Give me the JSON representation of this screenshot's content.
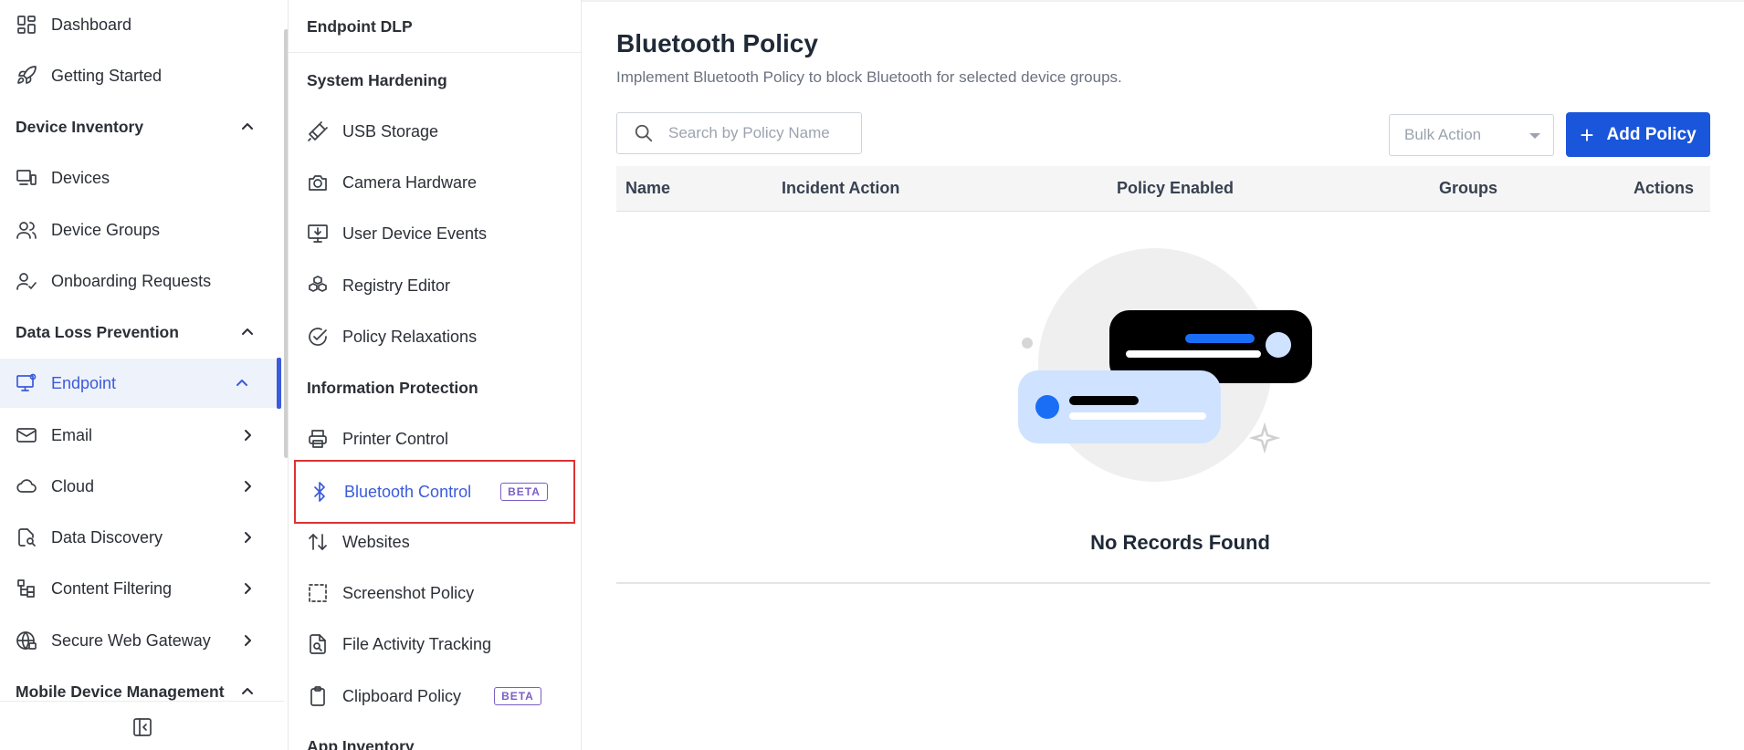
{
  "sidebar": {
    "items": {
      "dashboard": "Dashboard",
      "getting_started": "Getting Started",
      "device_inventory": "Device Inventory",
      "devices": "Devices",
      "device_groups": "Device Groups",
      "onboarding_requests": "Onboarding Requests",
      "data_loss_prevention": "Data Loss Prevention",
      "endpoint": "Endpoint",
      "email": "Email",
      "cloud": "Cloud",
      "data_discovery": "Data Discovery",
      "content_filtering": "Content Filtering",
      "secure_web_gateway": "Secure Web Gateway",
      "mobile_device_management": "Mobile Device Management"
    },
    "active_color": "#3b5bdb"
  },
  "subpanel": {
    "header": "Endpoint DLP",
    "sections": {
      "system_hardening": "System Hardening",
      "information_protection": "Information Protection",
      "app_inventory": "App Inventory"
    },
    "items": {
      "usb_storage": "USB Storage",
      "camera_hardware": "Camera Hardware",
      "user_device_events": "User Device Events",
      "registry_editor": "Registry Editor",
      "policy_relaxations": "Policy Relaxations",
      "printer_control": "Printer Control",
      "bluetooth_control": "Bluetooth Control",
      "websites": "Websites",
      "screenshot_policy": "Screenshot Policy",
      "file_activity_tracking": "File Activity Tracking",
      "clipboard_policy": "Clipboard Policy"
    },
    "badge_beta": "BETA"
  },
  "main": {
    "title": "Bluetooth Policy",
    "subtitle": "Implement Bluetooth Policy to block Bluetooth for selected device groups.",
    "search_placeholder": "Search by Policy Name",
    "bulk_action": "Bulk Action",
    "add_policy": "Add Policy",
    "columns": {
      "name": "Name",
      "incident_action": "Incident Action",
      "policy_enabled": "Policy Enabled",
      "groups": "Groups",
      "actions": "Actions"
    },
    "empty_message": "No Records Found",
    "primary_color": "#1a56db"
  }
}
